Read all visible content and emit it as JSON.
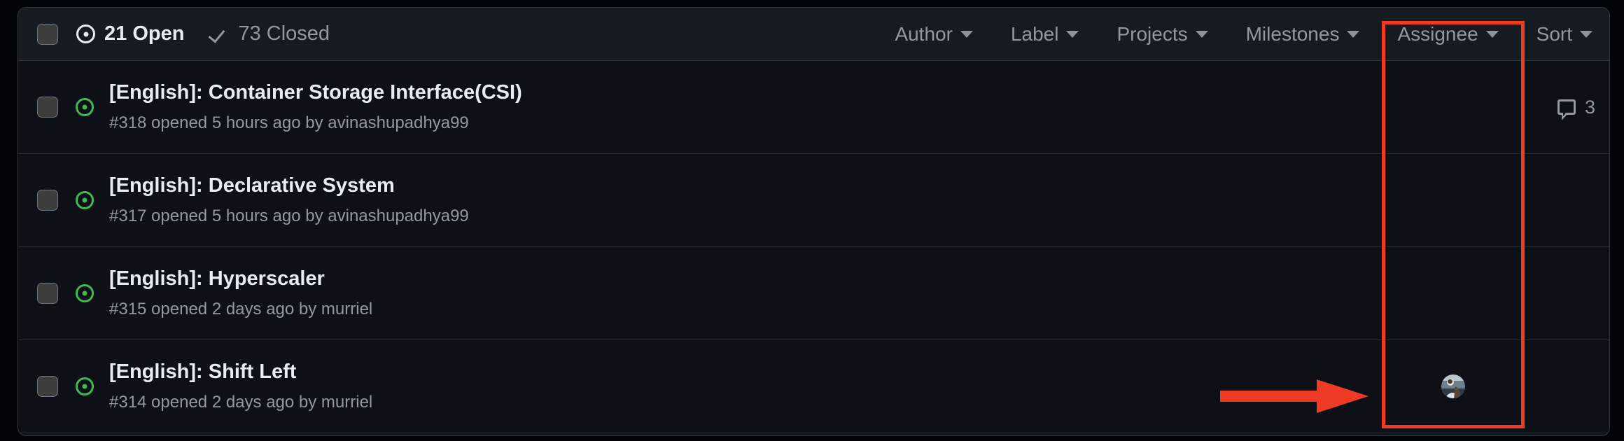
{
  "theme": {
    "page_bg": "#010409",
    "container_bg": "#0d1117",
    "header_bg": "#161b22",
    "border": "#30363d",
    "text_primary": "#e6edf3",
    "text_muted": "#9198a1",
    "open_green": "#3fb950",
    "annotation_red": "#ef3b25"
  },
  "header": {
    "select_all_checkbox": "select-all",
    "open": {
      "icon": "issue-opened-icon",
      "count": "21",
      "label": "21 Open"
    },
    "closed": {
      "icon": "check-icon",
      "count": "73",
      "label": "73 Closed"
    },
    "filters": [
      {
        "label": "Author",
        "icon": "chevron-down-icon"
      },
      {
        "label": "Label",
        "icon": "chevron-down-icon"
      },
      {
        "label": "Projects",
        "icon": "chevron-down-icon"
      },
      {
        "label": "Milestones",
        "icon": "chevron-down-icon"
      },
      {
        "label": "Assignee",
        "icon": "chevron-down-icon"
      },
      {
        "label": "Sort",
        "icon": "chevron-down-icon"
      }
    ]
  },
  "annotations": {
    "highlight_box": {
      "target": "Assignee",
      "color": "#ef3b25"
    },
    "arrow": {
      "points_to": "assignee-avatar",
      "color": "#ef3b25"
    }
  },
  "issues": [
    {
      "state_icon": "issue-opened-icon",
      "title": "[English]: Container Storage Interface(CSI)",
      "meta": "#318 opened 5 hours ago by avinashupadhya99",
      "number": "#318",
      "author": "avinashupadhya99",
      "opened": "5 hours ago",
      "comments": "3",
      "assignee": ""
    },
    {
      "state_icon": "issue-opened-icon",
      "title": "[English]: Declarative System",
      "meta": "#317 opened 5 hours ago by avinashupadhya99",
      "number": "#317",
      "author": "avinashupadhya99",
      "opened": "5 hours ago",
      "comments": "",
      "assignee": ""
    },
    {
      "state_icon": "issue-opened-icon",
      "title": "[English]: Hyperscaler",
      "meta": "#315 opened 2 days ago by murriel",
      "number": "#315",
      "author": "murriel",
      "opened": "2 days ago",
      "comments": "",
      "assignee": ""
    },
    {
      "state_icon": "issue-opened-icon",
      "title": "[English]: Shift Left",
      "meta": "#314 opened 2 days ago by murriel",
      "number": "#314",
      "author": "murriel",
      "opened": "2 days ago",
      "comments": "",
      "assignee": "assignee-avatar"
    }
  ]
}
